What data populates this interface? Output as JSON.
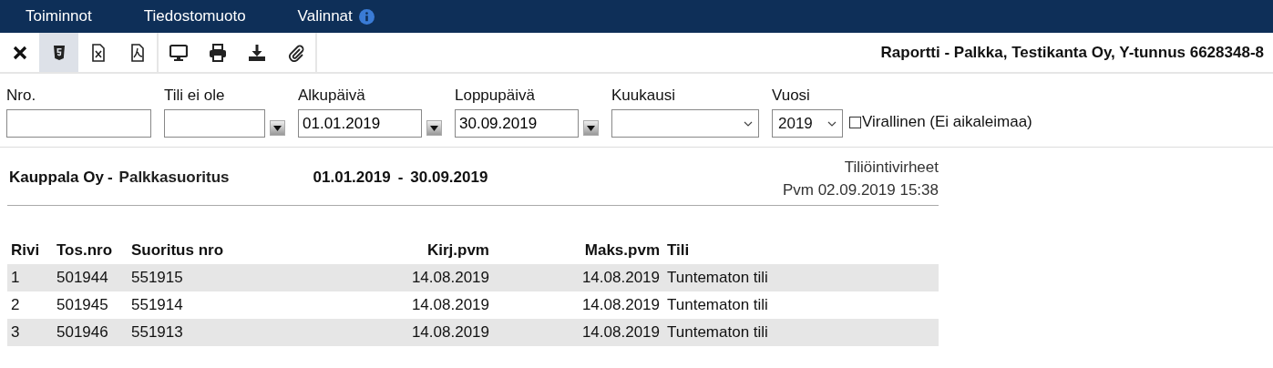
{
  "menu": [
    {
      "label": "Toiminnot",
      "info": false
    },
    {
      "label": "Tiedostomuoto",
      "info": false
    },
    {
      "label": "Valinnat",
      "info": true
    }
  ],
  "toolbar": {
    "groups": [
      [
        {
          "selected": false
        },
        {
          "selected": true
        },
        {
          "selected": false
        },
        {
          "selected": false
        }
      ],
      [
        {
          "selected": false
        },
        {
          "selected": false
        },
        {
          "selected": false
        },
        {
          "selected": false
        }
      ]
    ],
    "title": "Raportti - Palkka, Testikanta Oy, Y-tunnus 6628348-8"
  },
  "filters": [
    {
      "label": "Nro.",
      "kind": "text"
    },
    {
      "label": "Tili ei ole",
      "kind": "combo"
    },
    {
      "label": "Alkupäivä",
      "kind": "combo",
      "value": "01.01.2019"
    },
    {
      "label": "Loppupäivä",
      "kind": "combo",
      "value": "30.09.2019"
    },
    {
      "label": "Kuukausi",
      "kind": "select"
    },
    {
      "label": "Vuosi",
      "kind": "select",
      "value": "2019"
    }
  ],
  "official": {
    "label": "Virallinen (Ei aikaleimaa)",
    "checked": false
  },
  "report": {
    "company": "Kauppala Oy",
    "dash": "-",
    "type": "Palkkasuoritus",
    "start": "01.01.2019",
    "range_dash": "-",
    "end": "30.09.2019",
    "title": "Tiliöintivirheet",
    "printed": "Pvm 02.09.2019 15:38"
  },
  "table": {
    "columns": [
      "Rivi",
      "Tos.nro",
      "Suoritus nro",
      "Kirj.pvm",
      "Maks.pvm",
      "Tili"
    ],
    "rows": [
      [
        "1",
        "501944",
        "551915",
        "14.08.2019",
        "14.08.2019",
        "Tuntematon tili"
      ],
      [
        "2",
        "501945",
        "551914",
        "14.08.2019",
        "14.08.2019",
        "Tuntematon tili"
      ],
      [
        "3",
        "501946",
        "551913",
        "14.08.2019",
        "14.08.2019",
        "Tuntematon tili"
      ]
    ]
  }
}
